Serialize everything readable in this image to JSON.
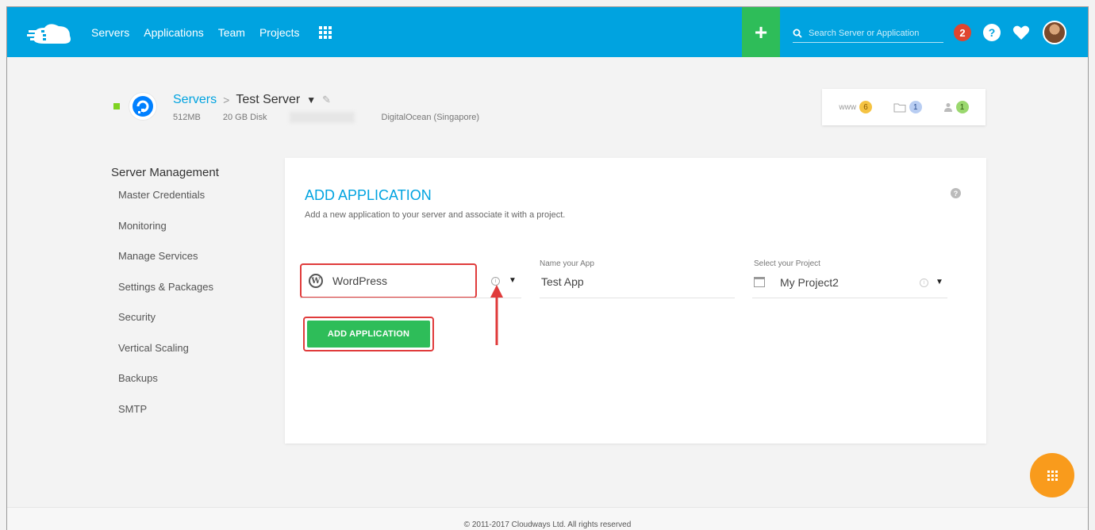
{
  "nav": {
    "items": [
      "Servers",
      "Applications",
      "Team",
      "Projects"
    ],
    "search_placeholder": "Search Server or Application",
    "notifications_count": "2",
    "help_label": "?"
  },
  "server": {
    "breadcrumb_root": "Servers",
    "breadcrumb_sep": ">",
    "name": "Test Server",
    "ram": "512MB",
    "disk": "20 GB Disk",
    "provider": "DigitalOcean (Singapore)",
    "stats": [
      {
        "icon": "www-icon",
        "label": "www",
        "count": "6",
        "color": "#f5c342"
      },
      {
        "icon": "folder-icon",
        "label": "",
        "count": "1",
        "color": "#b8cdf2"
      },
      {
        "icon": "users-icon",
        "label": "",
        "count": "1",
        "color": "#9ad86e"
      }
    ]
  },
  "sidebar": {
    "title": "Server Management",
    "items": [
      "Master Credentials",
      "Monitoring",
      "Manage Services",
      "Settings & Packages",
      "Security",
      "Vertical Scaling",
      "Backups",
      "SMTP"
    ]
  },
  "form": {
    "title": "ADD APPLICATION",
    "subtitle": "Add a new application to your server and associate it with a project.",
    "application_value": "WordPress",
    "app_name_label": "Name your App",
    "app_name_value": "Test App",
    "project_label": "Select your Project",
    "project_value": "My Project2",
    "submit_label": "ADD APPLICATION"
  },
  "footer": {
    "text": "© 2011-2017 Cloudways Ltd. All rights reserved"
  },
  "colors": {
    "brand": "#00a3e0",
    "success": "#2ebd59",
    "highlight": "#e03b3b",
    "fab": "#f99b1c"
  }
}
